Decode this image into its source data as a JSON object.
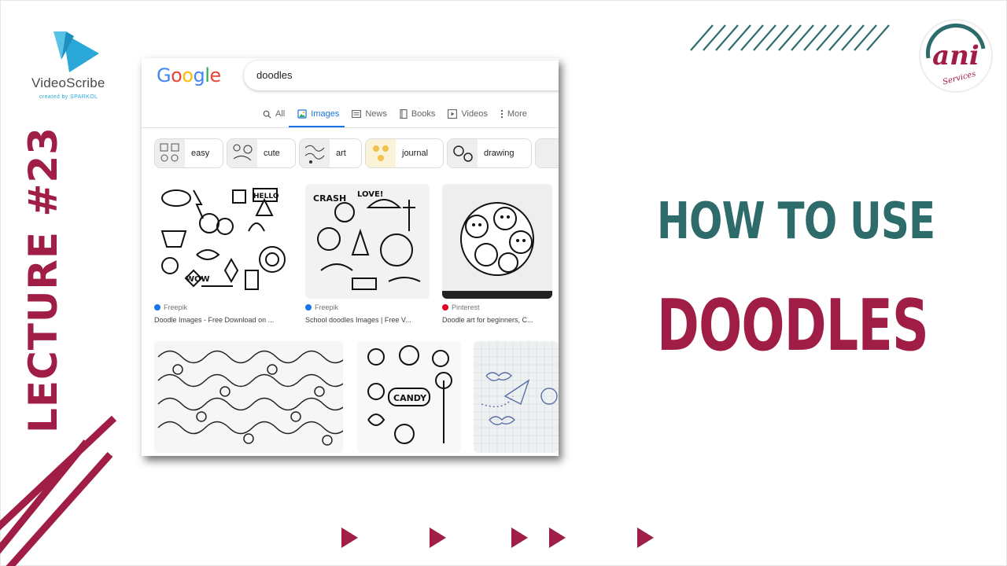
{
  "branding": {
    "videoscribe_name": "VideoScribe",
    "videoscribe_sub": "created by SPARKOL",
    "ani_main": "ani",
    "ani_sub": "Services"
  },
  "lecture_label": "LECTURE #23",
  "headline": {
    "line1": "HOW TO USE",
    "line2": "DOODLES"
  },
  "google": {
    "logo_letters": [
      "G",
      "o",
      "o",
      "g",
      "l",
      "e"
    ],
    "logo_colors": [
      "#4285F4",
      "#EA4335",
      "#FBBC05",
      "#4285F4",
      "#34A853",
      "#EA4335"
    ],
    "query": "doodles",
    "tabs": [
      {
        "label": "All",
        "icon": "search-icon",
        "active": false
      },
      {
        "label": "Images",
        "icon": "image-icon",
        "active": true
      },
      {
        "label": "News",
        "icon": "news-icon",
        "active": false
      },
      {
        "label": "Books",
        "icon": "book-icon",
        "active": false
      },
      {
        "label": "Videos",
        "icon": "video-icon",
        "active": false
      },
      {
        "label": "More",
        "icon": "more-vert-icon",
        "active": false
      }
    ],
    "chips": [
      "easy",
      "cute",
      "art",
      "journal",
      "drawing"
    ],
    "results": [
      {
        "source": "Freepik",
        "title": "Doodle Images - Free Download on ..."
      },
      {
        "source": "Freepik",
        "title": "School doodles Images | Free V..."
      },
      {
        "source": "Pinterest",
        "title": "Doodle art for beginners, C..."
      }
    ]
  },
  "colors": {
    "accent_red": "#a01d45",
    "accent_teal": "#2e6b6b",
    "google_blue": "#1a73e8"
  }
}
